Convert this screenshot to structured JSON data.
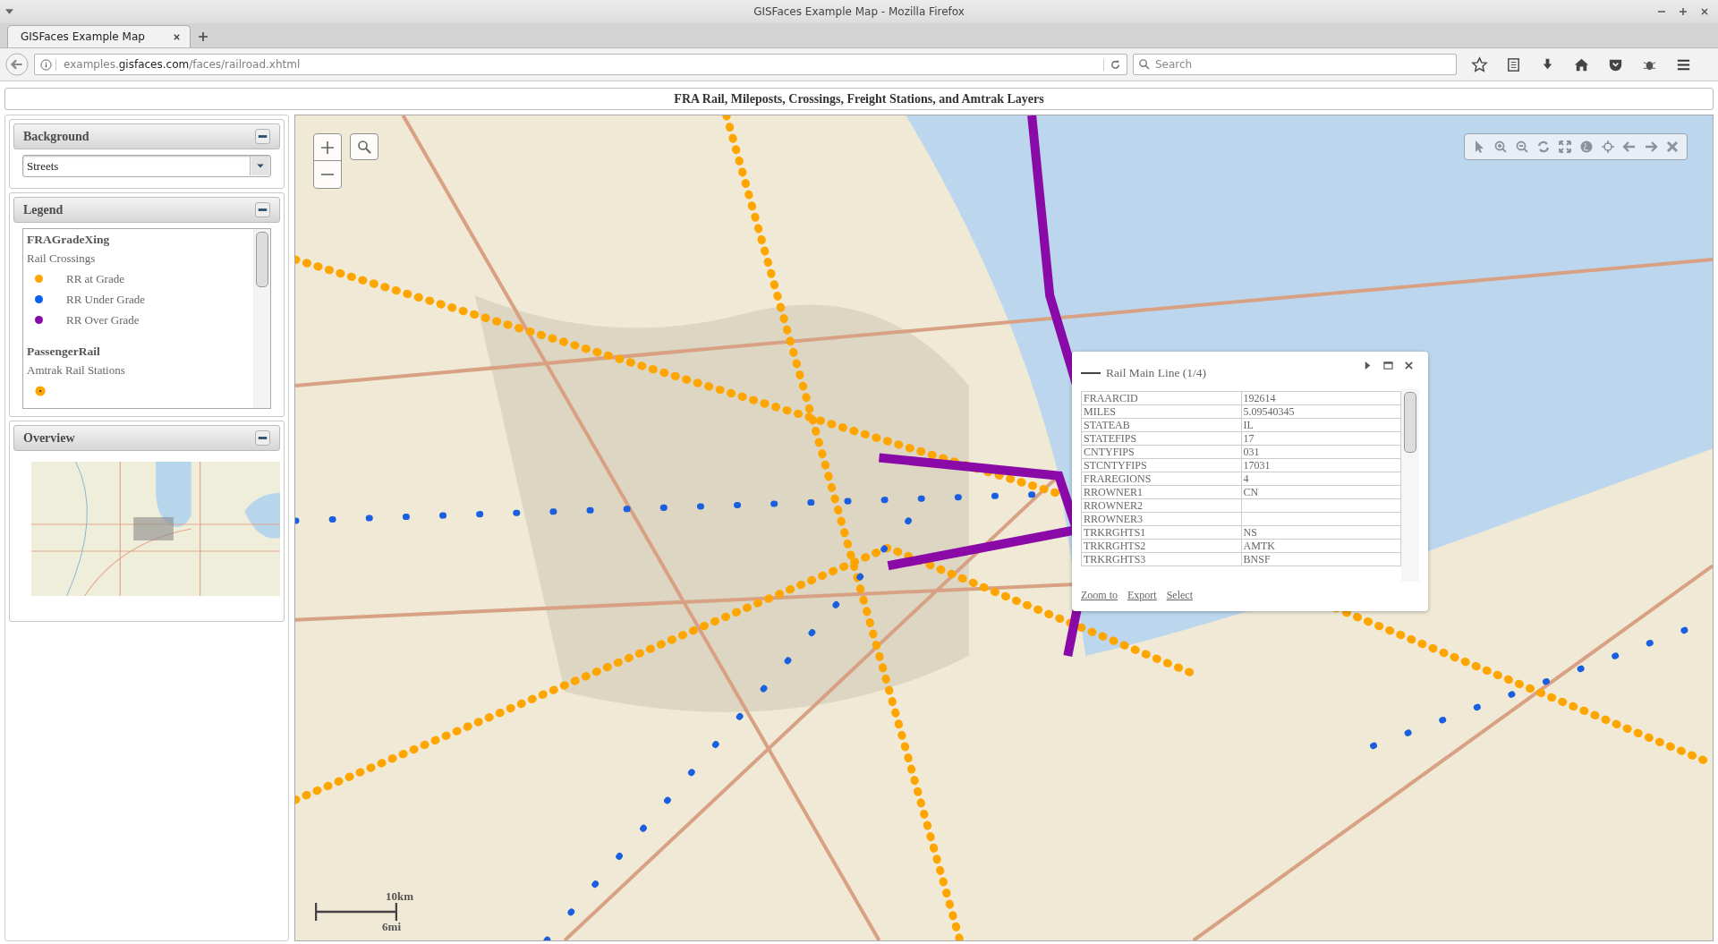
{
  "window": {
    "title": "GISFaces Example Map - Mozilla Firefox"
  },
  "tabs": [
    {
      "label": "GISFaces Example Map",
      "selected": true
    }
  ],
  "address_bar": {
    "prefix": "examples.",
    "domain": "gisfaces.com",
    "path": "/faces/railroad.xhtml"
  },
  "search": {
    "placeholder": "Search"
  },
  "page_title": "FRA Rail, Mileposts, Crossings, Freight Stations, and Amtrak Layers",
  "background_panel": {
    "title": "Background",
    "value": "Streets"
  },
  "legend_panel": {
    "title": "Legend",
    "groups": [
      {
        "name": "FRAGradeXing",
        "subtitle": "Rail Crossings",
        "items": [
          {
            "kind": "dot",
            "label": "RR at Grade",
            "color": "#ffa500"
          },
          {
            "kind": "dot",
            "label": "RR Under Grade",
            "color": "#0a5ff0"
          },
          {
            "kind": "dot",
            "label": "RR Over Grade",
            "color": "#8a0aa8"
          }
        ]
      },
      {
        "name": "PassengerRail",
        "subtitle": "Amtrak Rail Stations",
        "items": [
          {
            "kind": "station",
            "color": "#ffa500"
          }
        ]
      }
    ]
  },
  "overview_panel": {
    "title": "Overview"
  },
  "popup": {
    "title": "Rail Main Line (1/4)",
    "rows": [
      {
        "field": "FRAARCID",
        "value": "192614"
      },
      {
        "field": "MILES",
        "value": "5.09540345"
      },
      {
        "field": "STATEAB",
        "value": "IL"
      },
      {
        "field": "STATEFIPS",
        "value": "17"
      },
      {
        "field": "CNTYFIPS",
        "value": "031"
      },
      {
        "field": "STCNTYFIPS",
        "value": "17031"
      },
      {
        "field": "FRAREGIONS",
        "value": "4"
      },
      {
        "field": "RROWNER1",
        "value": "CN"
      },
      {
        "field": "RROWNER2"
      },
      {
        "field": "RROWNER3"
      },
      {
        "field": "TRKRGHTS1",
        "value": "NS"
      },
      {
        "field": "TRKRGHTS2",
        "value": "AMTK"
      },
      {
        "field": "TRKRGHTS3",
        "value": "BNSF"
      }
    ],
    "links": [
      "Zoom to",
      "Export",
      "Select"
    ]
  },
  "scale": {
    "metric": "10km",
    "imperial": "6mi"
  }
}
